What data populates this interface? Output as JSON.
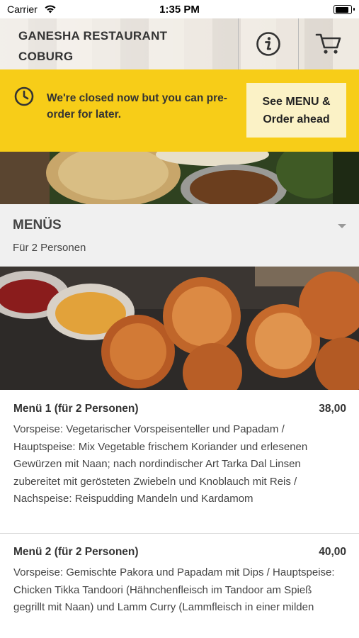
{
  "status_bar": {
    "carrier": "Carrier",
    "time": "1:35 PM"
  },
  "header": {
    "title_line1": "GANESHA RESTAURANT",
    "title_line2": "COBURG",
    "info_icon": "info-icon",
    "cart_icon": "cart-icon"
  },
  "banner": {
    "icon": "clock-icon",
    "message": "We're closed now but you can pre-order for later.",
    "cta_line1": "See MENU &",
    "cta_line2": "Order ahead",
    "background": "#f7cd18"
  },
  "category": {
    "title": "MENÜS",
    "subtitle": "Für 2 Personen"
  },
  "items": [
    {
      "name": "Menü 1 (für 2 Personen)",
      "price": "38,00",
      "description": "Vorspeise: Vegetarischer Vorspeisenteller und Papadam / Hauptspeise: Mix Vegetable frischem Koriander und erlesenen Gewürzen mit Naan; nach nordindischer Art Tarka Dal Linsen zubereitet mit gerösteten Zwiebeln und Knoblauch mit Reis / Nachspeise: Reispudding Mandeln und Kardamom"
    },
    {
      "name": "Menü 2 (für 2 Personen)",
      "price": "40,00",
      "description": "Vorspeise: Gemischte Pakora und Papadam mit Dips / Hauptspeise: Chicken Tikka Tandoori (Hähnchenfleisch im Tandoor am Spieß gegrillt mit Naan) und Lamm Curry (Lammfleisch in einer milden"
    }
  ]
}
